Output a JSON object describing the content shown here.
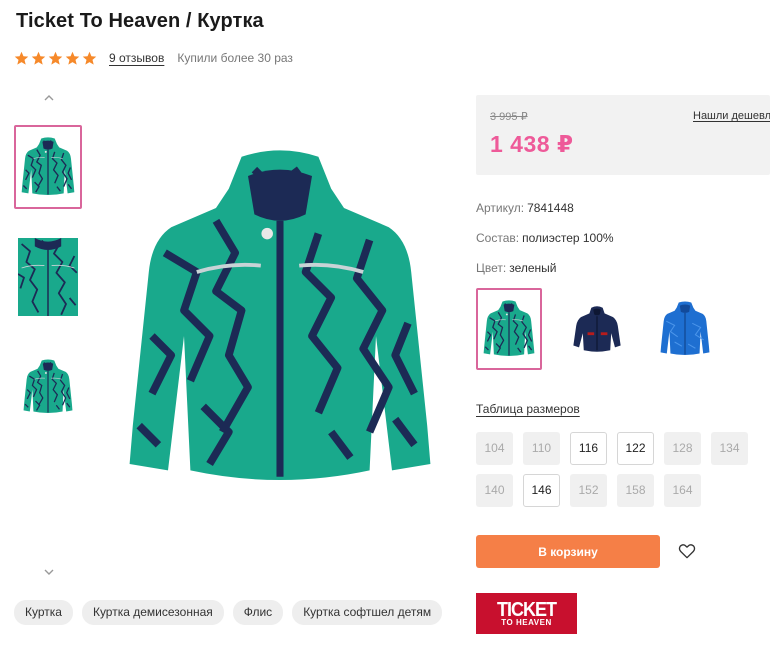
{
  "product": {
    "title": "Ticket To Heaven / Куртка",
    "rating_stars": 5,
    "reviews_label": "9 отзывов",
    "bought_label": "Купили более 30 раз"
  },
  "gallery": {
    "thumbnails": [
      "green-jacket-front",
      "green-jacket-detail",
      "green-jacket-back"
    ],
    "active_index": 0
  },
  "price": {
    "old": "3 995 ₽",
    "current": "1 438 ₽",
    "cheaper_link": "Нашли дешевле?"
  },
  "details": {
    "article_label": "Артикул:",
    "article_value": "7841448",
    "composition_label": "Состав:",
    "composition_value": "полиэстер 100%",
    "color_label": "Цвет:",
    "color_value": "зеленый"
  },
  "color_options": [
    {
      "name": "green",
      "hex": "#19a98c",
      "active": true
    },
    {
      "name": "navy",
      "hex": "#1c2a55",
      "active": false
    },
    {
      "name": "blue",
      "hex": "#1e6fd1",
      "active": false
    }
  ],
  "size_table_label": "Таблица размеров",
  "sizes": [
    {
      "label": "104",
      "available": false
    },
    {
      "label": "110",
      "available": false
    },
    {
      "label": "116",
      "available": true
    },
    {
      "label": "122",
      "available": true
    },
    {
      "label": "128",
      "available": false
    },
    {
      "label": "134",
      "available": false
    },
    {
      "label": "140",
      "available": false
    },
    {
      "label": "146",
      "available": true
    },
    {
      "label": "152",
      "available": false
    },
    {
      "label": "158",
      "available": false
    },
    {
      "label": "164",
      "available": false
    }
  ],
  "actions": {
    "add_to_cart": "В корзину"
  },
  "brand": {
    "logo_line1": "TICKET",
    "logo_line2": "TO HEAVEN"
  },
  "tags": [
    "Куртка",
    "Куртка демисезонная",
    "Флис",
    "Куртка софтшел детям"
  ],
  "colors": {
    "accent_pink": "#ee5a99",
    "cart_orange": "#f57f47",
    "star_orange": "#f6892a",
    "brand_red": "#c8102e",
    "jacket_green": "#19a98c",
    "jacket_navy": "#1c2a55"
  }
}
